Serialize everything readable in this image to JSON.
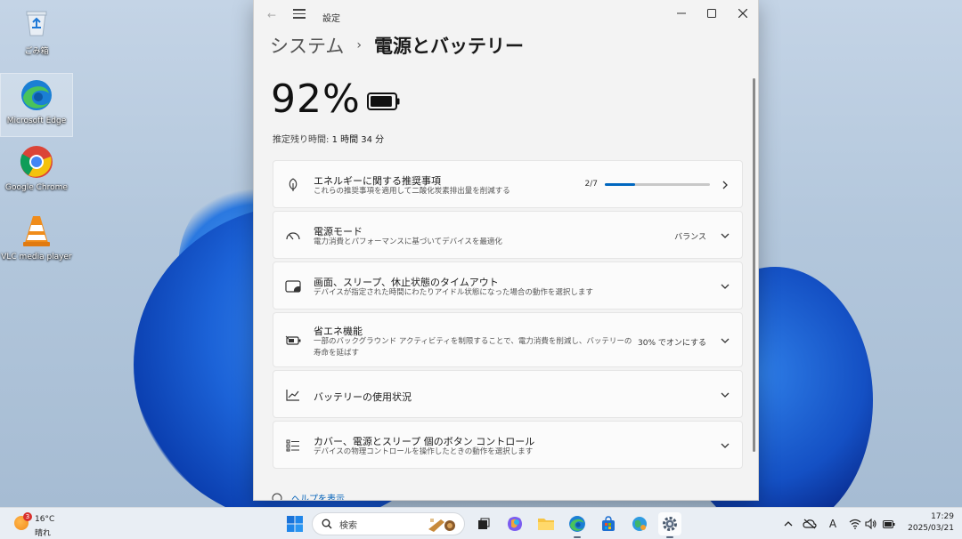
{
  "desktop": {
    "icons": [
      {
        "label": "ごみ箱"
      },
      {
        "label": "Microsoft Edge"
      },
      {
        "label": "Google Chrome"
      },
      {
        "label": "VLC media player"
      }
    ]
  },
  "window": {
    "title": "設定",
    "breadcrumb": {
      "parent": "システム",
      "separator": "›",
      "current": "電源とバッテリー"
    },
    "battery": {
      "percent_text": "92%",
      "level": 0.92
    },
    "estimate": {
      "label": "推定残り時間: ",
      "value": "1 時間 34 分"
    },
    "cards": [
      {
        "title": "エネルギーに関する推奨事項",
        "subtitle": "これらの推奨事項を適用して二酸化炭素排出量を削減する",
        "right": "2/7",
        "progress": 0.2857,
        "icon": "leaf-icon",
        "chevron": "chevron-right-icon"
      },
      {
        "title": "電源モード",
        "subtitle": "電力消費とパフォーマンスに基づいてデバイスを最適化",
        "right": "バランス",
        "icon": "power-mode-icon",
        "chevron": "chevron-down-icon"
      },
      {
        "title": "画面、スリープ、休止状態のタイムアウト",
        "subtitle": "デバイスが指定された時間にわたりアイドル状態になった場合の動作を選択します",
        "right": "",
        "icon": "screen-sleep-icon",
        "chevron": "chevron-down-icon"
      },
      {
        "title": "省エネ機能",
        "subtitle": "一部のバックグラウンド アクティビティを制限することで、電力消費を削減し、バッテリーの寿命を延ばす",
        "right": "30% でオンにする",
        "icon": "energy-saver-icon",
        "chevron": "chevron-down-icon"
      },
      {
        "title": "バッテリーの使用状況",
        "subtitle": "",
        "right": "",
        "icon": "usage-chart-icon",
        "chevron": "chevron-down-icon"
      },
      {
        "title": "カバー、電源とスリープ 個のボタン コントロール",
        "subtitle": "デバイスの物理コントロールを操作したときの動作を選択します",
        "right": "",
        "icon": "button-controls-icon",
        "chevron": "chevron-down-icon"
      }
    ],
    "help": "ヘルプを表示"
  },
  "taskbar": {
    "weather": {
      "badge": "3",
      "temp": "16°C",
      "condition": "晴れ"
    },
    "search_placeholder": "検索",
    "clock": {
      "time": "17:29",
      "date": "2025/03/21"
    },
    "ime": "A"
  },
  "colors": {
    "accent": "#0067c0",
    "window_bg": "#f3f3f3",
    "card_bg": "#fbfbfb",
    "taskbar_bg": "#e9eef4"
  }
}
